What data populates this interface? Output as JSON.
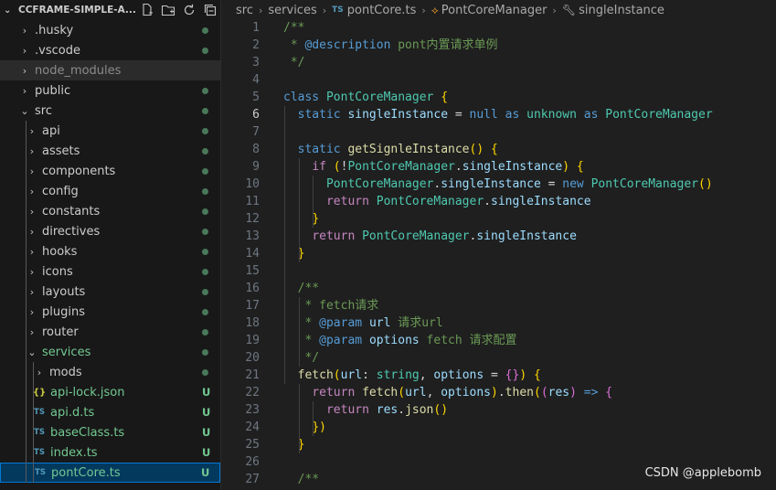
{
  "sidebar": {
    "title": "CCFRAME-SIMPLE-A...",
    "actions": [
      "new-file-icon",
      "new-folder-icon",
      "refresh-icon",
      "collapse-all-icon"
    ],
    "items": [
      {
        "label": ".husky",
        "type": "folder",
        "depth": 1,
        "expanded": false,
        "status": "dot"
      },
      {
        "label": ".vscode",
        "type": "folder",
        "depth": 1,
        "expanded": false,
        "status": "dot"
      },
      {
        "label": "node_modules",
        "type": "folder",
        "depth": 1,
        "expanded": false,
        "status": "ignored"
      },
      {
        "label": "public",
        "type": "folder",
        "depth": 1,
        "expanded": false,
        "status": "dot"
      },
      {
        "label": "src",
        "type": "folder",
        "depth": 1,
        "expanded": true,
        "status": "dot"
      },
      {
        "label": "api",
        "type": "folder",
        "depth": 2,
        "expanded": false,
        "status": "dot"
      },
      {
        "label": "assets",
        "type": "folder",
        "depth": 2,
        "expanded": false,
        "status": "dot"
      },
      {
        "label": "components",
        "type": "folder",
        "depth": 2,
        "expanded": false,
        "status": "dot"
      },
      {
        "label": "config",
        "type": "folder",
        "depth": 2,
        "expanded": false,
        "status": "dot"
      },
      {
        "label": "constants",
        "type": "folder",
        "depth": 2,
        "expanded": false,
        "status": "dot"
      },
      {
        "label": "directives",
        "type": "folder",
        "depth": 2,
        "expanded": false,
        "status": "dot"
      },
      {
        "label": "hooks",
        "type": "folder",
        "depth": 2,
        "expanded": false,
        "status": "dot"
      },
      {
        "label": "icons",
        "type": "folder",
        "depth": 2,
        "expanded": false,
        "status": "dot"
      },
      {
        "label": "layouts",
        "type": "folder",
        "depth": 2,
        "expanded": false,
        "status": "dot"
      },
      {
        "label": "plugins",
        "type": "folder",
        "depth": 2,
        "expanded": false,
        "status": "dot"
      },
      {
        "label": "router",
        "type": "folder",
        "depth": 2,
        "expanded": false,
        "status": "dot"
      },
      {
        "label": "services",
        "type": "folder",
        "depth": 2,
        "expanded": true,
        "status": "dot",
        "green": true
      },
      {
        "label": "mods",
        "type": "folder",
        "depth": 3,
        "expanded": false,
        "status": "dot"
      },
      {
        "label": "api-lock.json",
        "type": "json",
        "icon": "{}",
        "depth": 3,
        "status": "U"
      },
      {
        "label": "api.d.ts",
        "type": "ts",
        "icon": "TS",
        "depth": 3,
        "status": "U"
      },
      {
        "label": "baseClass.ts",
        "type": "ts",
        "icon": "TS",
        "depth": 3,
        "status": "U"
      },
      {
        "label": "index.ts",
        "type": "ts",
        "icon": "TS",
        "depth": 3,
        "status": "U"
      },
      {
        "label": "pontCore.ts",
        "type": "ts",
        "icon": "TS",
        "depth": 3,
        "status": "U",
        "selected": true
      }
    ]
  },
  "breadcrumb": {
    "parts": [
      "src",
      "services"
    ],
    "file_icon": "TS",
    "file": "pontCore.ts",
    "class_name": "PontCoreManager",
    "member": "singleInstance"
  },
  "editor": {
    "current_line": 6,
    "lines": [
      {
        "n": "1",
        "indent": 0,
        "text": "/**"
      },
      {
        "n": "2",
        "indent": 0,
        "text": " * @description pont内置请求单例"
      },
      {
        "n": "3",
        "indent": 0,
        "text": " */"
      },
      {
        "n": "4",
        "indent": 0,
        "text": ""
      },
      {
        "n": "5",
        "indent": 0,
        "text": "class PontCoreManager {"
      },
      {
        "n": "6",
        "indent": 1,
        "text": "  static singleInstance = null as unknown as PontCoreManager"
      },
      {
        "n": "7",
        "indent": 0,
        "text": ""
      },
      {
        "n": "8",
        "indent": 1,
        "text": "  static getSignleInstance() {"
      },
      {
        "n": "9",
        "indent": 2,
        "text": "    if (!PontCoreManager.singleInstance) {"
      },
      {
        "n": "10",
        "indent": 3,
        "text": "      PontCoreManager.singleInstance = new PontCoreManager()"
      },
      {
        "n": "11",
        "indent": 3,
        "text": "      return PontCoreManager.singleInstance"
      },
      {
        "n": "12",
        "indent": 2,
        "text": "    }"
      },
      {
        "n": "13",
        "indent": 2,
        "text": "    return PontCoreManager.singleInstance"
      },
      {
        "n": "14",
        "indent": 1,
        "text": "  }"
      },
      {
        "n": "15",
        "indent": 0,
        "text": ""
      },
      {
        "n": "16",
        "indent": 1,
        "text": "  /**"
      },
      {
        "n": "17",
        "indent": 1,
        "text": "   * fetch请求"
      },
      {
        "n": "18",
        "indent": 1,
        "text": "   * @param url 请求url"
      },
      {
        "n": "19",
        "indent": 1,
        "text": "   * @param options fetch 请求配置"
      },
      {
        "n": "20",
        "indent": 1,
        "text": "   */"
      },
      {
        "n": "21",
        "indent": 1,
        "text": "  fetch(url: string, options = {}) {"
      },
      {
        "n": "22",
        "indent": 2,
        "text": "    return fetch(url, options).then((res) => {"
      },
      {
        "n": "23",
        "indent": 3,
        "text": "      return res.json()"
      },
      {
        "n": "24",
        "indent": 2,
        "text": "    })"
      },
      {
        "n": "25",
        "indent": 1,
        "text": "  }"
      },
      {
        "n": "26",
        "indent": 0,
        "text": ""
      },
      {
        "n": "27",
        "indent": 1,
        "text": "  /**"
      }
    ]
  },
  "watermark": "CSDN @applebomb"
}
